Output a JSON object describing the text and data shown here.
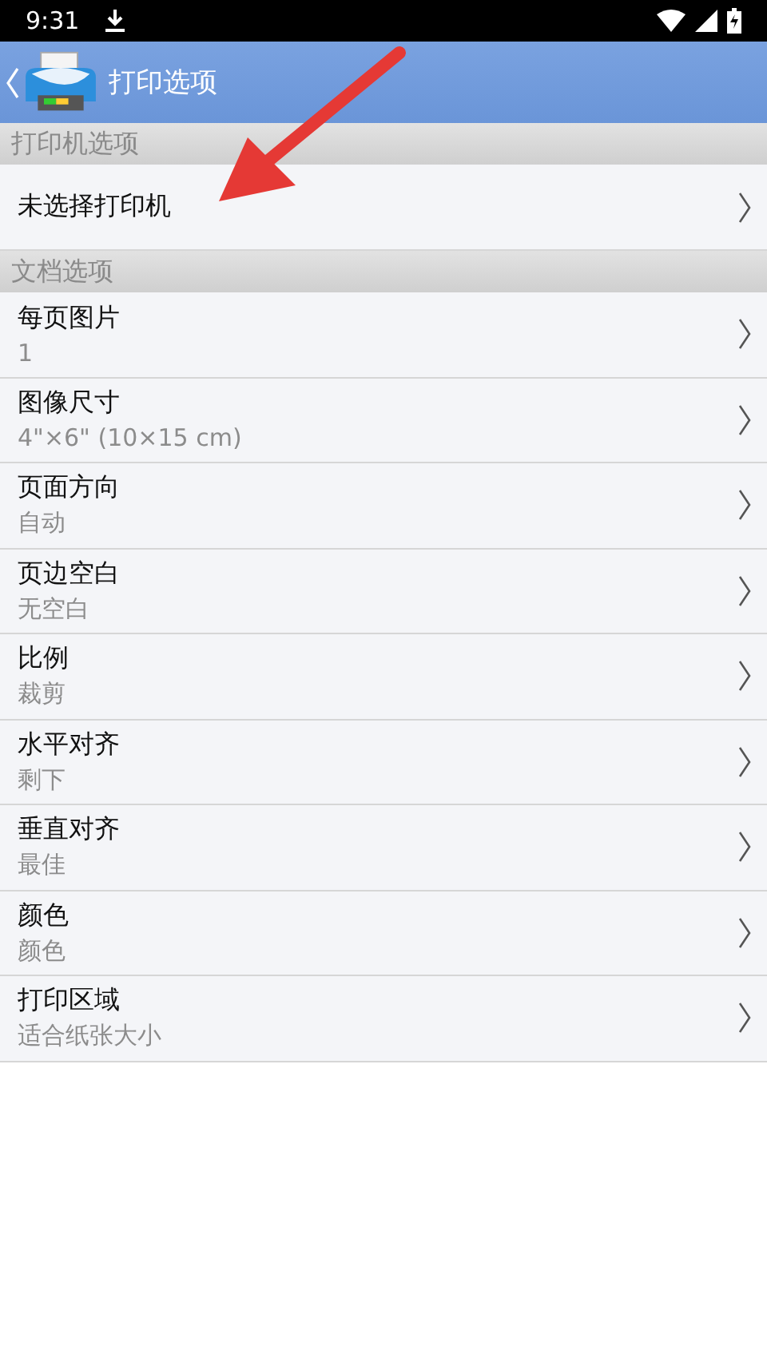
{
  "status_bar": {
    "time": "9:31"
  },
  "header": {
    "title": "打印选项"
  },
  "sections": [
    {
      "title": "打印机选项",
      "items": [
        {
          "label": "未选择打印机"
        }
      ]
    },
    {
      "title": "文档选项",
      "items": [
        {
          "label": "每页图片",
          "value": "1"
        },
        {
          "label": "图像尺寸",
          "value": "4\"×6\" (10×15 cm)"
        },
        {
          "label": "页面方向",
          "value": "自动"
        },
        {
          "label": "页边空白",
          "value": "无空白"
        },
        {
          "label": "比例",
          "value": "裁剪"
        },
        {
          "label": "水平对齐",
          "value": "剩下"
        },
        {
          "label": "垂直对齐",
          "value": "最佳"
        },
        {
          "label": "颜色",
          "value": "颜色"
        },
        {
          "label": "打印区域",
          "value": "适合纸张大小"
        }
      ]
    }
  ]
}
